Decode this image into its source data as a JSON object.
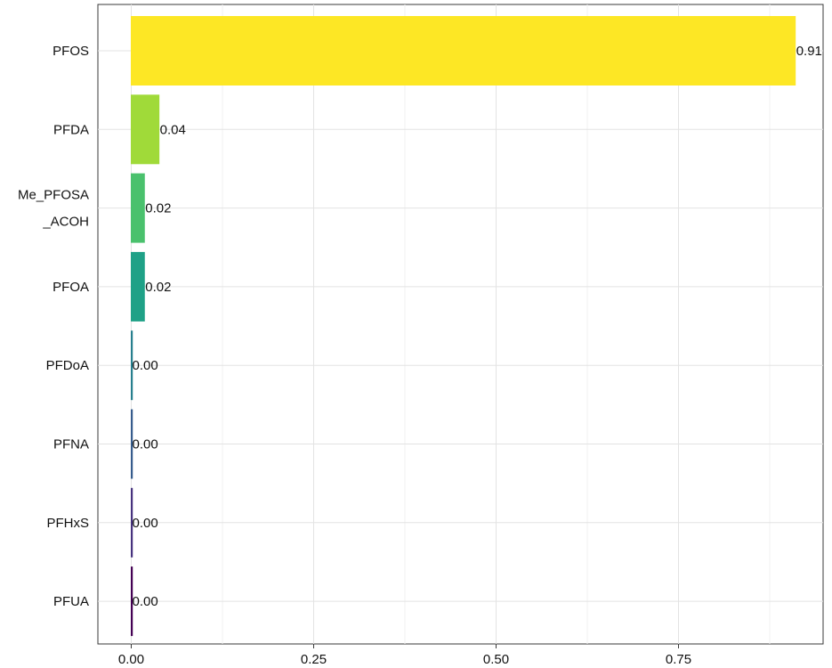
{
  "chart_data": {
    "type": "bar",
    "orientation": "horizontal",
    "categories": [
      "PFOS",
      "PFDA",
      "Me_PFOSA_ACOH",
      "PFOA",
      "PFDoA",
      "PFNA",
      "PFHxS",
      "PFUA"
    ],
    "category_label_lines": [
      [
        "PFOS"
      ],
      [
        "PFDA"
      ],
      [
        "Me_PFOSA",
        "_ACOH"
      ],
      [
        "PFOA"
      ],
      [
        "PFDoA"
      ],
      [
        "PFNA"
      ],
      [
        "PFHxS"
      ],
      [
        "PFUA"
      ]
    ],
    "values": [
      0.91,
      0.038,
      0.018,
      0.018,
      0.0,
      0.0,
      0.0,
      0.0
    ],
    "value_labels": [
      "0.91",
      "0.04",
      "0.02",
      "0.02",
      "0.00",
      "0.00",
      "0.00",
      "0.00"
    ],
    "colors": [
      "#FDE725",
      "#A0DA39",
      "#4AC16D",
      "#1FA187",
      "#277F8E",
      "#365C8D",
      "#46327E",
      "#440154"
    ],
    "x_ticks": [
      0,
      0.25,
      0.5,
      0.75
    ],
    "x_tick_labels": [
      "0.00",
      "0.25",
      "0.50",
      "0.75"
    ],
    "xlim": [
      0,
      0.95
    ],
    "title": "",
    "xlabel": "",
    "ylabel": "",
    "grid": true,
    "legend": "none"
  }
}
